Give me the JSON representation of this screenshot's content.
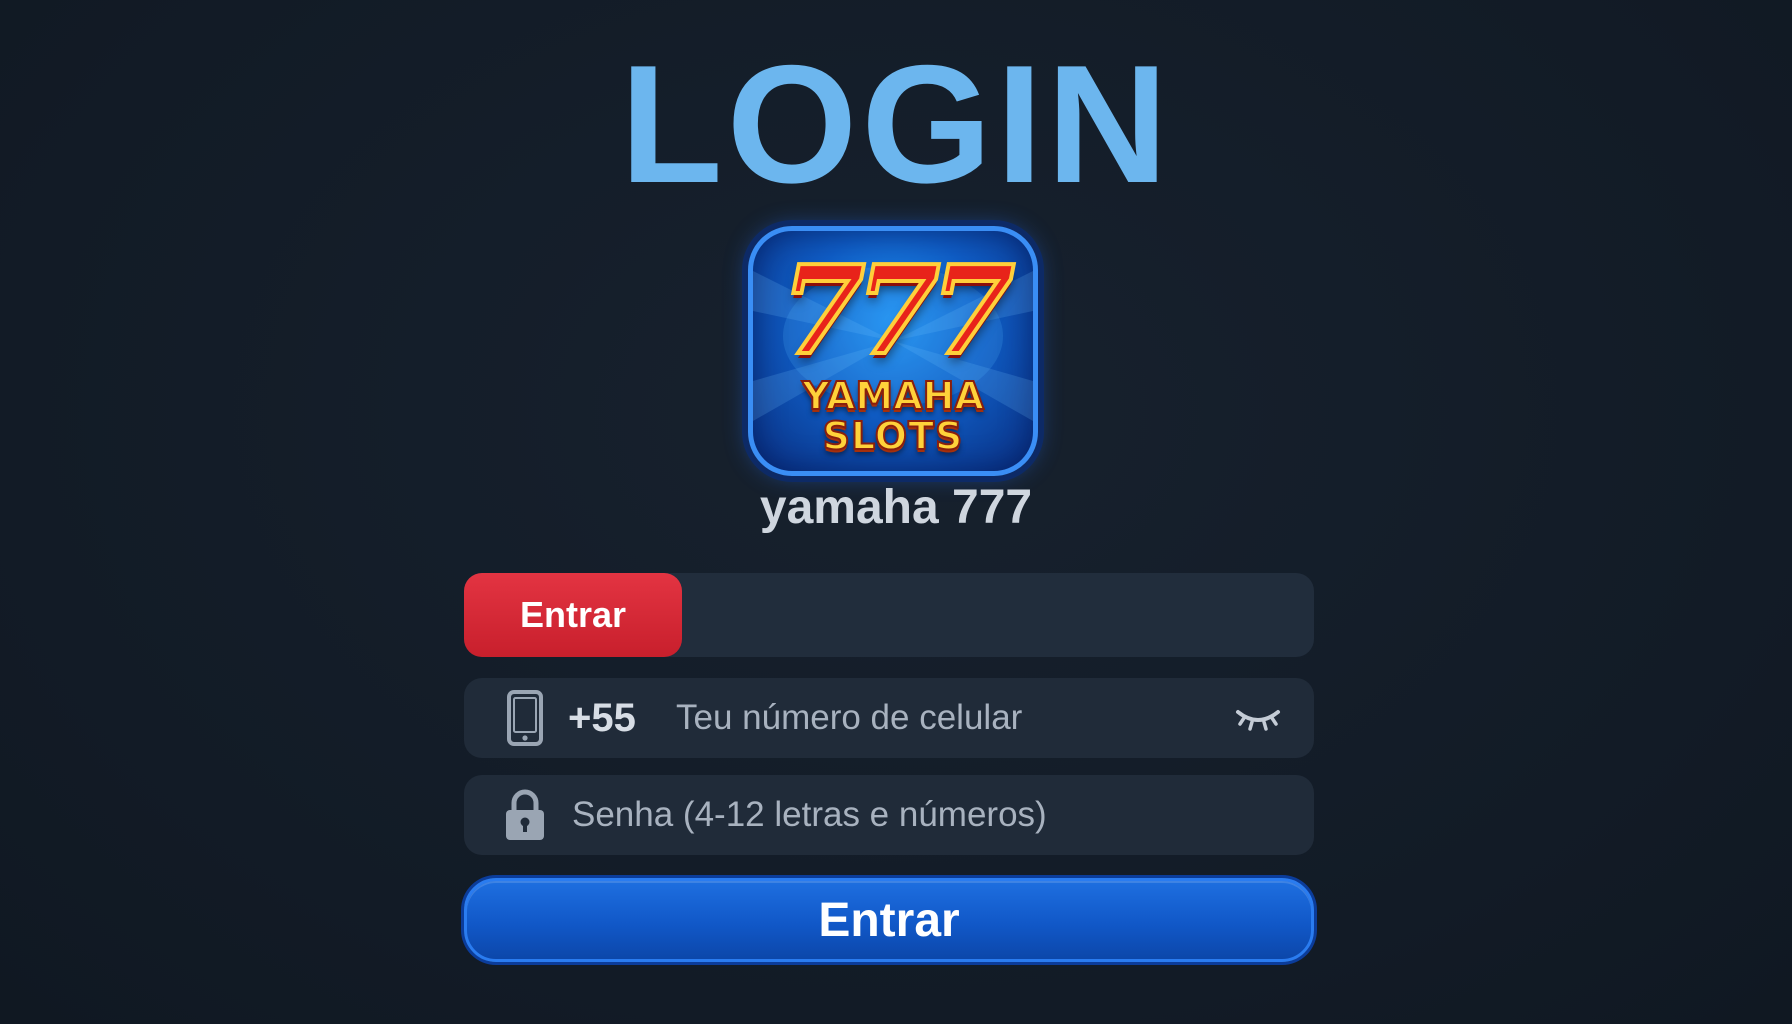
{
  "header": {
    "title": "LOGIN"
  },
  "brand": {
    "logo_icon": "yamaha-slots-777-logo",
    "logo_sevens": "777",
    "logo_line1": "YAMAHA",
    "logo_line2": "SLOTS",
    "app_name": "yamaha 777"
  },
  "tabs": {
    "active_label": "Entrar"
  },
  "form": {
    "phone": {
      "icon": "mobile-phone-icon",
      "country_code": "+55",
      "placeholder": "Teu número de celular",
      "value": "",
      "toggle_icon": "eye-closed-icon"
    },
    "password": {
      "icon": "lock-icon",
      "placeholder": "Senha (4-12 letras e números)",
      "value": ""
    },
    "submit_label": "Entrar"
  },
  "colors": {
    "background": "#131c27",
    "title": "#6cb6ee",
    "tab_active": "#d8283a",
    "field_bg": "#202b39",
    "submit": "#1158c8"
  }
}
